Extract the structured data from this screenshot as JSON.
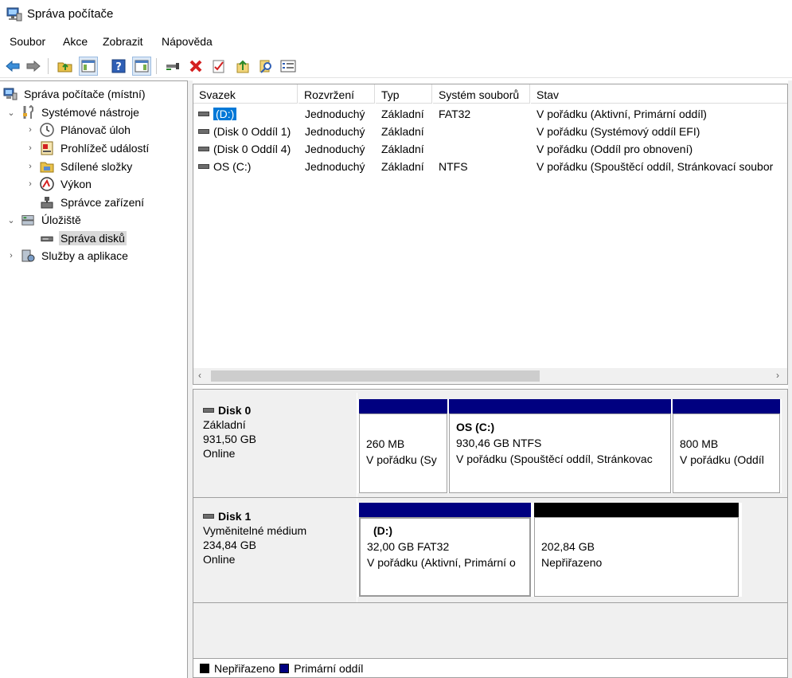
{
  "window": {
    "title": "Správa počítače"
  },
  "menu": [
    "Soubor",
    "Akce",
    "Zobrazit",
    "Nápověda"
  ],
  "toolbar": {
    "buttons": [
      "back-icon",
      "forward-icon",
      "up-folder-icon",
      "show-hide-tree-icon",
      "help-icon",
      "show-hide-action-pane-icon",
      "connect-icon",
      "delete-icon",
      "properties-icon",
      "export-icon",
      "search-icon",
      "list-icon"
    ]
  },
  "tree": {
    "root": "Správa počítače (místní)",
    "items": [
      {
        "label": "Systémové nástroje"
      },
      {
        "label": "Plánovač úloh"
      },
      {
        "label": "Prohlížeč událostí"
      },
      {
        "label": "Sdílené složky"
      },
      {
        "label": "Výkon"
      },
      {
        "label": "Správce zařízení"
      },
      {
        "label": "Úložiště"
      },
      {
        "label": "Správa disků"
      },
      {
        "label": "Služby a aplikace"
      }
    ]
  },
  "volumes": {
    "columns": [
      "Svazek",
      "Rozvržení",
      "Typ",
      "Systém souborů",
      "Stav"
    ],
    "rows": [
      {
        "svazek": "(D:)",
        "rozvrzeni": "Jednoduchý",
        "typ": "Základní",
        "fs": "FAT32",
        "stav": "V pořádku (Aktivní, Primární oddíl)"
      },
      {
        "svazek": "(Disk 0 Oddíl 1)",
        "rozvrzeni": "Jednoduchý",
        "typ": "Základní",
        "fs": "",
        "stav": "V pořádku (Systémový oddíl EFI)"
      },
      {
        "svazek": "(Disk 0 Oddíl 4)",
        "rozvrzeni": "Jednoduchý",
        "typ": "Základní",
        "fs": "",
        "stav": "V pořádku (Oddíl pro obnovení)"
      },
      {
        "svazek": "OS (C:)",
        "rozvrzeni": "Jednoduchý",
        "typ": "Základní",
        "fs": "NTFS",
        "stav": "V pořádku (Spouštěcí oddíl, Stránkovací soubor"
      }
    ]
  },
  "disks": [
    {
      "name": "Disk 0",
      "type": "Základní",
      "size": "931,50 GB",
      "status": "Online",
      "partitions": [
        {
          "title": "",
          "line1": "260 MB",
          "line2": "V pořádku (Sy"
        },
        {
          "title": "OS  (C:)",
          "line1": "930,46 GB NTFS",
          "line2": "V pořádku (Spouštěcí oddíl, Stránkovac"
        },
        {
          "title": "",
          "line1": "800 MB",
          "line2": "V pořádku (Oddíl"
        }
      ]
    },
    {
      "name": "Disk 1",
      "type": "Vyměnitelné médium",
      "size": "234,84 GB",
      "status": "Online",
      "partitions": [
        {
          "title": "(D:)",
          "line1": "32,00 GB FAT32",
          "line2": "V pořádku (Aktivní, Primární o"
        },
        {
          "title": "",
          "line1": "202,84 GB",
          "line2": "Nepřiřazeno"
        }
      ]
    }
  ],
  "legend": [
    {
      "label": "Nepřiřazeno",
      "color": "#000000"
    },
    {
      "label": "Primární oddíl",
      "color": "#000080"
    }
  ],
  "colors": {
    "primary": "#000080",
    "unallocated": "#000000",
    "selection": "#0078d7"
  }
}
